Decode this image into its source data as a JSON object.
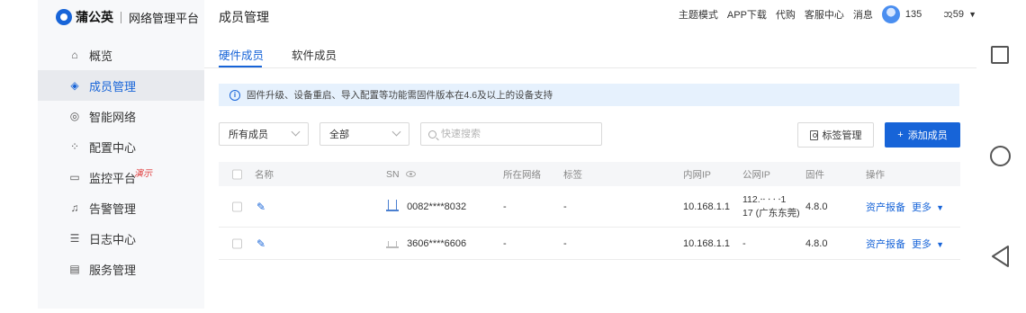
{
  "brand": {
    "name": "蒲公英",
    "subtitle": "网络管理平台"
  },
  "sidebar": {
    "items": [
      {
        "label": "概览",
        "icon": "home-icon",
        "active": false
      },
      {
        "label": "成员管理",
        "icon": "layers-icon",
        "active": true
      },
      {
        "label": "智能网络",
        "icon": "network-icon",
        "active": false
      },
      {
        "label": "配置中心",
        "icon": "grid-icon",
        "active": false
      },
      {
        "label": "监控平台",
        "icon": "monitor-icon",
        "active": false,
        "tag": "演示"
      },
      {
        "label": "告警管理",
        "icon": "bell-icon",
        "active": false
      },
      {
        "label": "日志中心",
        "icon": "log-icon",
        "active": false
      },
      {
        "label": "服务管理",
        "icon": "service-icon",
        "active": false
      }
    ]
  },
  "header": {
    "title": "成员管理",
    "links": [
      "主题模式",
      "APP下载",
      "代购",
      "客服中心",
      "消息"
    ],
    "user_id": "135",
    "user_name": "ᩋ59"
  },
  "tabs": [
    {
      "label": "硬件成员",
      "active": true
    },
    {
      "label": "软件成员",
      "active": false
    }
  ],
  "notice": {
    "text": "固件升级、设备重启、导入配置等功能需固件版本在4.6及以上的设备支持"
  },
  "filters": {
    "member_select": "所有成员",
    "status_select": "全部",
    "search_placeholder": "快速搜索"
  },
  "buttons": {
    "tag_manage": "标签管理",
    "add_member": "添加成员"
  },
  "table": {
    "columns": [
      "名称",
      "SN",
      "所在网络",
      "标签",
      "内网IP",
      "公网IP",
      "固件",
      "操作"
    ],
    "rows": [
      {
        "sn": "0082****8032",
        "network": "-",
        "tag": "-",
        "lan_ip": "10.168.1.1",
        "wan_ip_line1": "112.⸱⸱  ⸱   ⸱ ⸱1",
        "wan_ip_line2": "17 (广东东莞)",
        "firmware": "4.8.0",
        "action_report": "资产报备",
        "action_more": "更多"
      },
      {
        "sn": "3606****6606",
        "network": "-",
        "tag": "-",
        "lan_ip": "10.168.1.1",
        "wan_ip_line1": "-",
        "wan_ip_line2": "",
        "firmware": "4.8.0",
        "action_report": "资产报备",
        "action_more": "更多"
      }
    ]
  },
  "colors": {
    "accent": "#1764d8",
    "notice_bg": "#e6f1fd",
    "sidebar_bg": "#f7f8fa"
  }
}
